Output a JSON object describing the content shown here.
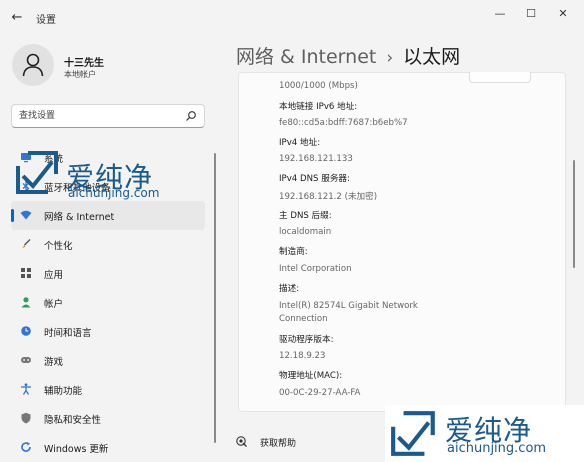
{
  "window": {
    "title": "设置",
    "back_glyph": "←",
    "minimize_glyph": "—",
    "maximize_glyph": "☐",
    "close_glyph": "✕"
  },
  "profile": {
    "name": "十三先生",
    "account_type": "本地帐户"
  },
  "search": {
    "placeholder": "查找设置"
  },
  "sidebar": {
    "items": [
      {
        "label": "系统",
        "icon": "system-icon",
        "color": "#2f76d2"
      },
      {
        "label": "蓝牙和其他设备",
        "icon": "bluetooth-icon",
        "color": "#2f76d2"
      },
      {
        "label": "网络 & Internet",
        "icon": "wifi-icon",
        "color": "#2f76d2",
        "active": true
      },
      {
        "label": "个性化",
        "icon": "brush-icon",
        "color": "#d98a2b"
      },
      {
        "label": "应用",
        "icon": "apps-icon",
        "color": "#555555"
      },
      {
        "label": "帐户",
        "icon": "account-icon",
        "color": "#2c9d5a"
      },
      {
        "label": "时间和语言",
        "icon": "globe-clock-icon",
        "color": "#2f76d2"
      },
      {
        "label": "游戏",
        "icon": "gamepad-icon",
        "color": "#777777"
      },
      {
        "label": "辅助功能",
        "icon": "accessibility-icon",
        "color": "#2f76d2"
      },
      {
        "label": "隐私和安全性",
        "icon": "shield-icon",
        "color": "#666666"
      },
      {
        "label": "Windows 更新",
        "icon": "update-icon",
        "color": "#2f76d2"
      }
    ]
  },
  "breadcrumb": {
    "parent": "网络 & Internet",
    "separator": "›",
    "current": "以太网"
  },
  "properties": [
    {
      "kind": "value",
      "text": "1000/1000 (Mbps)"
    },
    {
      "kind": "label",
      "text": "本地链接 IPv6 地址:"
    },
    {
      "kind": "value",
      "text": "fe80::cd5a:bdff:7687:b6eb%7"
    },
    {
      "kind": "label",
      "text": "IPv4 地址:"
    },
    {
      "kind": "value",
      "text": "192.168.121.133"
    },
    {
      "kind": "label",
      "text": "IPv4 DNS 服务器:"
    },
    {
      "kind": "value",
      "text": "192.168.121.2 (未加密)"
    },
    {
      "kind": "label",
      "text": "主 DNS 后缀:"
    },
    {
      "kind": "value",
      "text": "localdomain"
    },
    {
      "kind": "label",
      "text": "制造商:"
    },
    {
      "kind": "value",
      "text": "Intel Corporation"
    },
    {
      "kind": "label",
      "text": "描述:"
    },
    {
      "kind": "value",
      "text": "Intel(R) 82574L Gigabit Network"
    },
    {
      "kind": "value",
      "text": "Connection"
    },
    {
      "kind": "label",
      "text": "驱动程序版本:"
    },
    {
      "kind": "value",
      "text": "12.18.9.23"
    },
    {
      "kind": "label",
      "text": "物理地址(MAC):"
    },
    {
      "kind": "value",
      "text": "00-0C-29-27-AA-FA"
    }
  ],
  "help": {
    "label": "获取帮助"
  },
  "watermark": {
    "brand": "爱纯净",
    "domain": "aichunjing.com",
    "color": "#1a5a8c"
  }
}
